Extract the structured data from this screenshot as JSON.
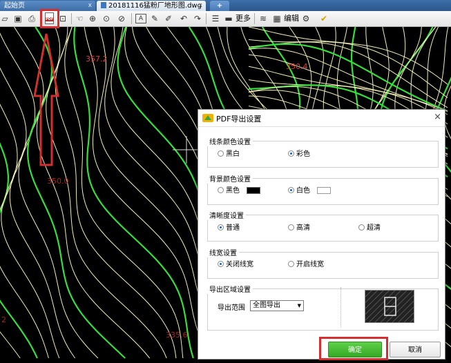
{
  "tabs": {
    "home_label": "起始页",
    "home_close": "x",
    "file_label": "20181116猛粉厂地形图.dwg",
    "file_close": "x",
    "add_label": "+"
  },
  "toolbar": {
    "more_label": "更多",
    "edit_label": "编辑",
    "pdf_badge": "PDF"
  },
  "canvas": {
    "elevations": [
      "357.2",
      "350.4",
      "350.0",
      "335.6",
      "2"
    ]
  },
  "dialog": {
    "title": "PDF导出设置",
    "close": "×",
    "line_color": {
      "title": "线条颜色设置",
      "options": [
        "黑白",
        "彩色"
      ],
      "selected": "彩色"
    },
    "bg_color": {
      "title": "背景颜色设置",
      "options": [
        "黑色",
        "白色"
      ],
      "selected": "白色",
      "swatch_black": "#000000",
      "swatch_white": "#ffffff"
    },
    "clarity": {
      "title": "清晰度设置",
      "options": [
        "普通",
        "高清",
        "超清"
      ],
      "selected": "普通"
    },
    "line_width": {
      "title": "线宽设置",
      "options": [
        "关闭线宽",
        "开启线宽"
      ],
      "selected": "关闭线宽"
    },
    "export_area": {
      "title": "导出区域设置",
      "range_label": "导出范围",
      "range_value": "全图导出"
    },
    "ok_label": "确定",
    "cancel_label": "取消"
  },
  "colors": {
    "contour_white": "#f2efb8",
    "contour_green": "#35e03a",
    "elevation_red": "#e53935",
    "highlight": "#d32f2f",
    "ok_green": "#3fb82f"
  }
}
